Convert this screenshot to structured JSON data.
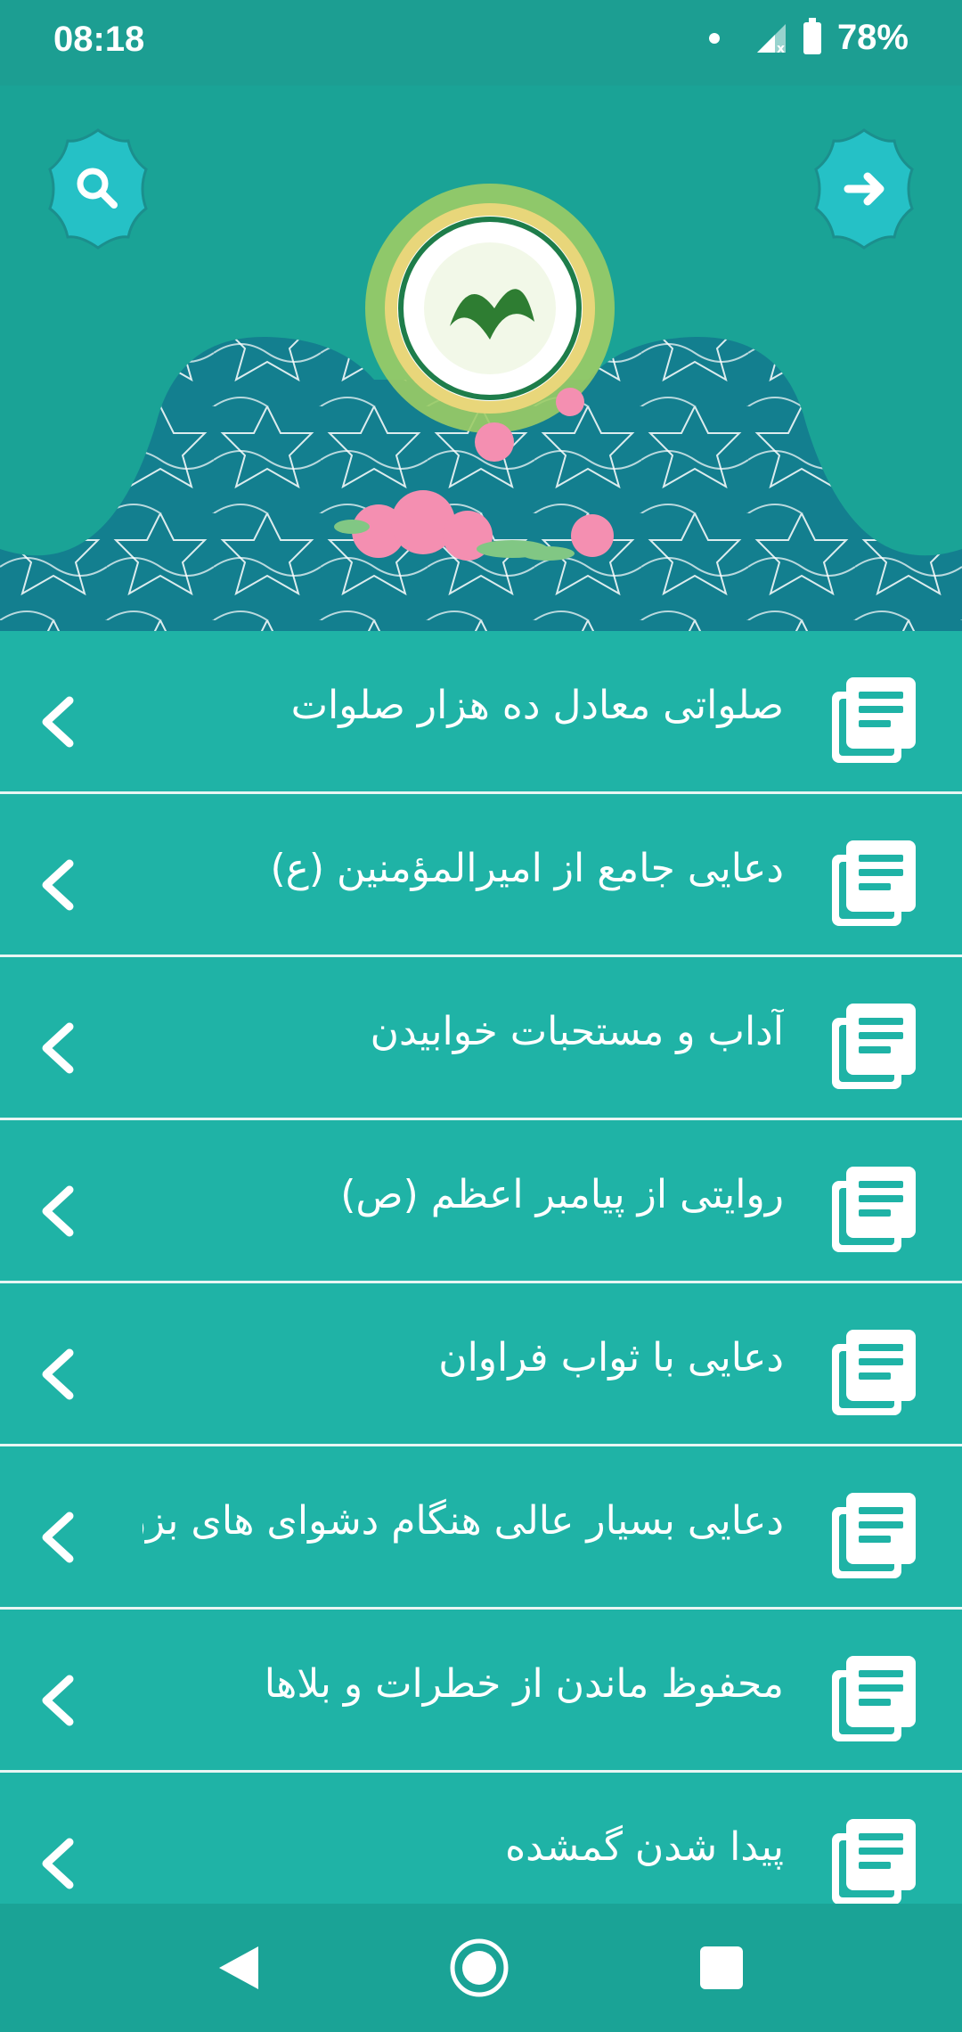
{
  "status_bar": {
    "time": "08:18",
    "battery": "78%"
  },
  "header": {
    "search_icon": "search-icon",
    "forward_icon": "arrow-right-icon",
    "emblem_image": "calligraphy-emblem-with-roses"
  },
  "colors": {
    "primary": "#1fb3a6",
    "header": "#1aa396",
    "pattern_bg": "#137f8f",
    "button": "#25c1c6",
    "divider": "#e8f6f4"
  },
  "list": {
    "items": [
      {
        "label": "صلواتی معادل ده هزار صلوات"
      },
      {
        "label": "دعایی جامع از امیرالمؤمنین (ع)"
      },
      {
        "label": "آداب و مستحبات خوابیدن"
      },
      {
        "label": "روایتی از پیامبر اعظم (ص)"
      },
      {
        "label": "دعایی با ثواب فراوان"
      },
      {
        "label": "دعایی بسیار عالی هنگام دشوای های بزرگ"
      },
      {
        "label": "محفوظ ماندن از خطرات و بلاها"
      },
      {
        "label": "پیدا شدن گمشده"
      }
    ],
    "item_icon": "document-stack-icon",
    "chevron_icon": "chevron-left-icon"
  },
  "nav_bar": {
    "back_icon": "back-triangle-icon",
    "home_icon": "home-circle-icon",
    "recent_icon": "recent-square-icon"
  }
}
